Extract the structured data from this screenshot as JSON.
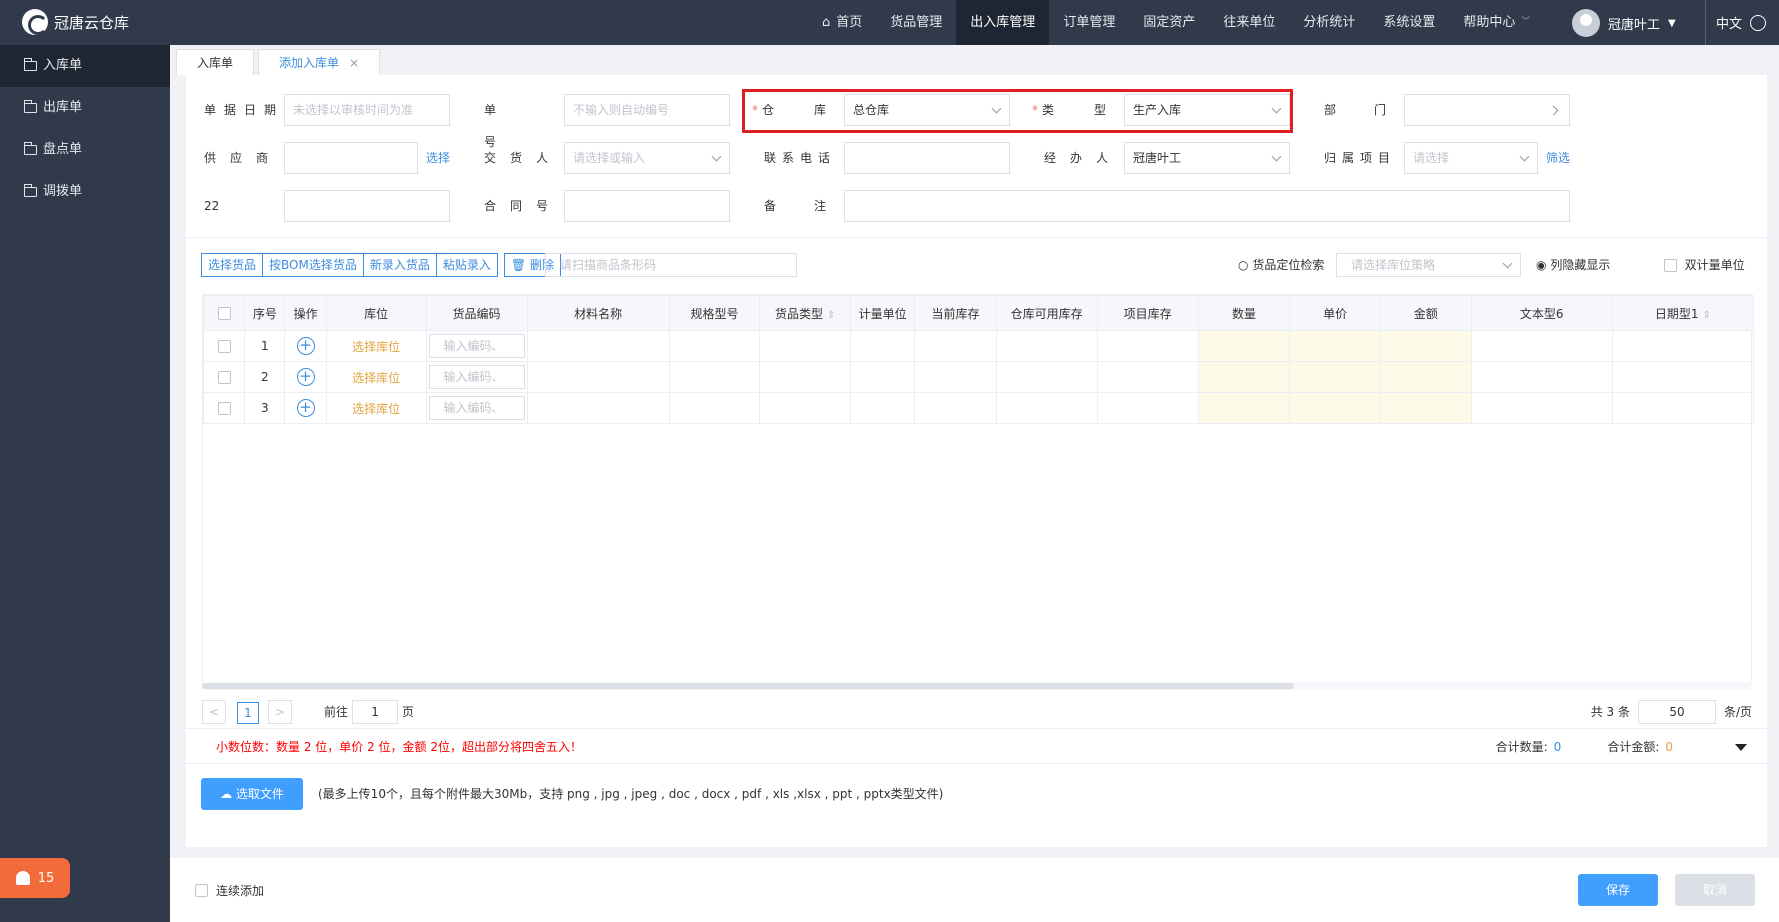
{
  "app": {
    "logo_text": "冠唐云仓库"
  },
  "nav": {
    "items": [
      "首页",
      "货品管理",
      "出入库管理",
      "订单管理",
      "固定资产",
      "往来单位",
      "分析统计",
      "系统设置",
      "帮助中心"
    ],
    "active": "出入库管理"
  },
  "user": {
    "name": "冠唐叶工",
    "lang": "中文"
  },
  "sidebar": {
    "items": [
      "入库单",
      "出库单",
      "盘点单",
      "调拨单"
    ]
  },
  "alert": {
    "count": "15"
  },
  "tabs": [
    {
      "label": "入库单"
    },
    {
      "label": "添加入库单",
      "close": "×"
    }
  ],
  "form": {
    "date_label": "单据日期",
    "date_placeholder": "未选择以审核时间为准",
    "no_label": "单号",
    "no_placeholder": "不输入则自动编号",
    "warehouse_label": "仓库",
    "warehouse_value": "总仓库",
    "type_label": "类型",
    "type_value": "生产入库",
    "dept_label": "部门",
    "supplier_label": "供应商",
    "supplier_select": "选择",
    "deliverer_label": "交货人",
    "deliverer_placeholder": "请选择或输入",
    "phone_label": "联系电话",
    "handler_label": "经办人",
    "handler_value": "冠唐叶工",
    "project_label": "归属项目",
    "project_placeholder": "请选择",
    "project_filter": "筛选",
    "custom_label": "22",
    "contract_label": "合同号",
    "remark_label": "备注"
  },
  "toolbar": {
    "buttons": [
      "选择货品",
      "按BOM选择货品",
      "新录入货品",
      "粘贴录入"
    ],
    "delete": "删除",
    "scan_placeholder": "请扫描商品条形码",
    "locate": "货品定位检索",
    "location_strategy_placeholder": "请选择库位策略",
    "hidden_cols": "列隐藏显示",
    "dual_unit": "双计量单位"
  },
  "table": {
    "headers": [
      "序号",
      "操作",
      "库位",
      "货品编码",
      "材料名称",
      "规格型号",
      "货品类型",
      "计量单位",
      "当前库存",
      "仓库可用库存",
      "项目库存",
      "数量",
      "单价",
      "金额",
      "文本型6",
      "日期型1"
    ],
    "rows": [
      {
        "no": "1",
        "location": "选择库位",
        "code_placeholder": "输入编码、"
      },
      {
        "no": "2",
        "location": "选择库位",
        "code_placeholder": "输入编码、"
      },
      {
        "no": "3",
        "location": "选择库位",
        "code_placeholder": "输入编码、"
      }
    ]
  },
  "pager": {
    "prev": "<",
    "page": "1",
    "next": ">",
    "goto_prefix": "前往",
    "goto_value": "1",
    "goto_suffix": "页",
    "total": "共 3 条",
    "page_size": "50",
    "page_size_unit": "条/页"
  },
  "summary": {
    "warning": "小数位数：数量 2 位，单价 2 位，金额 2位，超出部分将四舍五入！",
    "qty_label": "合计数量:",
    "qty_value": "0",
    "amount_label": "合计金额:",
    "amount_value": "0"
  },
  "upload": {
    "button": "选取文件",
    "hint": "(最多上传10个，且每个附件最大30Mb，支持 png , jpg , jpeg , doc , docx , pdf , xls ,xlsx , ppt , pptx类型文件)"
  },
  "footer": {
    "continue_add": "连续添加",
    "save": "保存",
    "cancel": "取消"
  }
}
